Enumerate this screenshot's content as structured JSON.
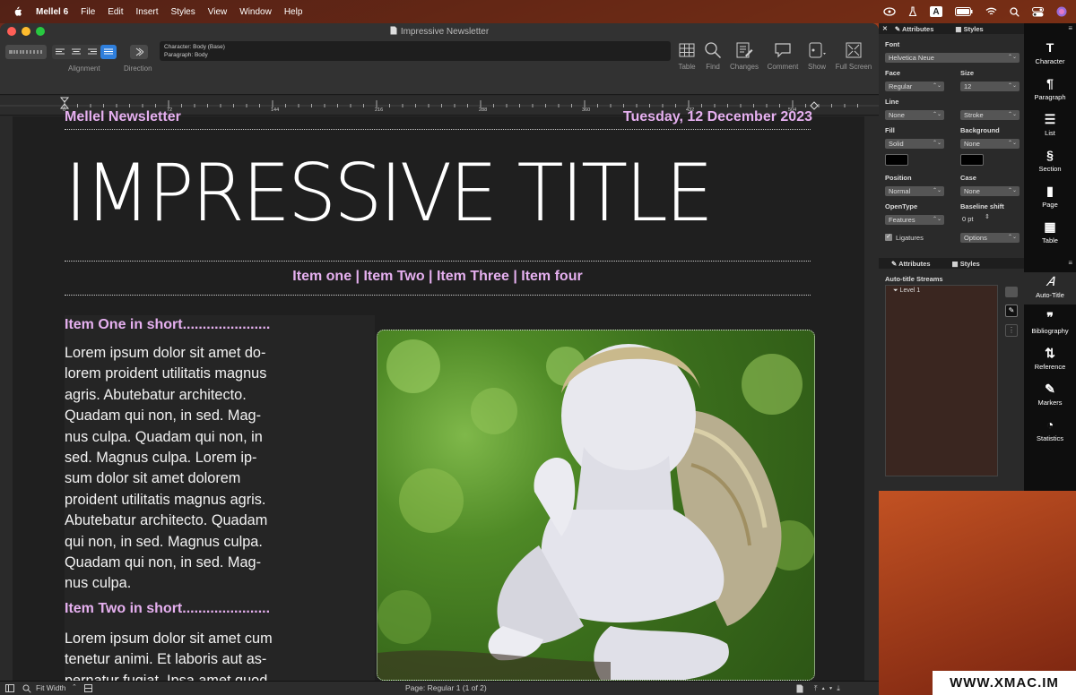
{
  "menubar": {
    "app_name": "Mellel 6",
    "items": [
      "File",
      "Edit",
      "Insert",
      "Styles",
      "View",
      "Window",
      "Help"
    ],
    "status_letter": "A"
  },
  "window": {
    "title": "Impressive Newsletter"
  },
  "toolbar": {
    "alignment_label": "Alignment",
    "direction_label": "Direction",
    "info_character": "Character: Body (Base)",
    "info_paragraph": "Paragraph: Body",
    "tools": [
      "Table",
      "Find",
      "Changes",
      "Comment",
      "Show",
      "Full Screen"
    ]
  },
  "ruler": {
    "marks": [
      "0",
      "72",
      "144",
      "216",
      "288",
      "360",
      "432",
      "504"
    ]
  },
  "document": {
    "header_left": "Mellel Newsletter",
    "header_right": "Tuesday, 12 December 2023",
    "big_title": "IMPRESSIVE TITLE",
    "nav": "Item one | Item Two | Item Three | Item four",
    "section1_heading": "Item One in short......................",
    "section1_lines": [
      "Lorem ipsum dolor sit amet do-",
      "lorem proident utilitatis magnus",
      "agris. Abutebatur architecto.",
      "Quadam qui non, in sed. Mag-",
      "nus culpa. Quadam qui non, in",
      "sed. Magnus culpa. Lorem ip-",
      "sum dolor sit amet dolorem",
      "proident utilitatis magnus agris.",
      "Abutebatur architecto. Quadam",
      "qui non, in sed. Magnus culpa.",
      "Quadam qui non, in sed. Mag-",
      "nus culpa."
    ],
    "section2_heading": "Item Two in short......................",
    "section2_lines": [
      "Lorem ipsum dolor sit amet cum",
      "tenetur animi. Et laboris aut as-",
      "pernatur fugiat. Ipsa amet quod"
    ]
  },
  "statusbar": {
    "zoom": "Fit Width",
    "page_info": "Page: Regular 1 (1 of 2)"
  },
  "attributes_panel": {
    "tab_attributes": "Attributes",
    "tab_styles": "Styles",
    "font_label": "Font",
    "font_value": "Helvetica Neue",
    "face_label": "Face",
    "face_value": "Regular",
    "size_label": "Size",
    "size_value": "12",
    "line_label": "Line",
    "line_value": "None",
    "stroke_value": "Stroke",
    "fill_label": "Fill",
    "fill_value": "Solid",
    "background_label": "Background",
    "background_value": "None",
    "position_label": "Position",
    "position_value": "Normal",
    "case_label": "Case",
    "case_value": "None",
    "opentype_label": "OpenType",
    "opentype_value": "Features",
    "baseline_label": "Baseline shift",
    "baseline_value": "0 pt",
    "ligatures_label": "Ligatures",
    "options_value": "Options"
  },
  "streams_panel": {
    "tab_attributes": "Attributes",
    "tab_styles": "Styles",
    "title": "Auto-title Streams",
    "item": "Level 1"
  },
  "sidebar_top": [
    "Character",
    "Paragraph",
    "List",
    "Section",
    "Page",
    "Table"
  ],
  "sidebar_bottom": [
    "Auto-Title",
    "Bibliography",
    "Reference",
    "Markers",
    "Statistics"
  ],
  "watermark": "WWW.XMAC.IM"
}
